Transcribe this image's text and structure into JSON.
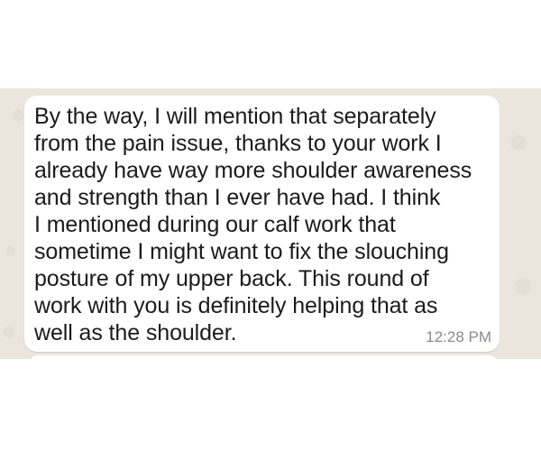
{
  "conversation": {
    "message": {
      "text": "By the way, I will mention that separately\nfrom the pain issue, thanks to your work I\nalready have way more shoulder awareness\nand strength than I ever have had.  I think\nI mentioned during our calf work that\nsometime I might want to fix the slouching\nposture of my upper back.  This round of\nwork with you is definitely helping that as\nwell as the shoulder.",
      "time": "12:28 PM"
    }
  },
  "colors": {
    "chat_background": "#ece5dd",
    "bubble_background": "#ffffff",
    "message_text": "#1b1b1b",
    "timestamp_text": "#8a8a8a"
  }
}
